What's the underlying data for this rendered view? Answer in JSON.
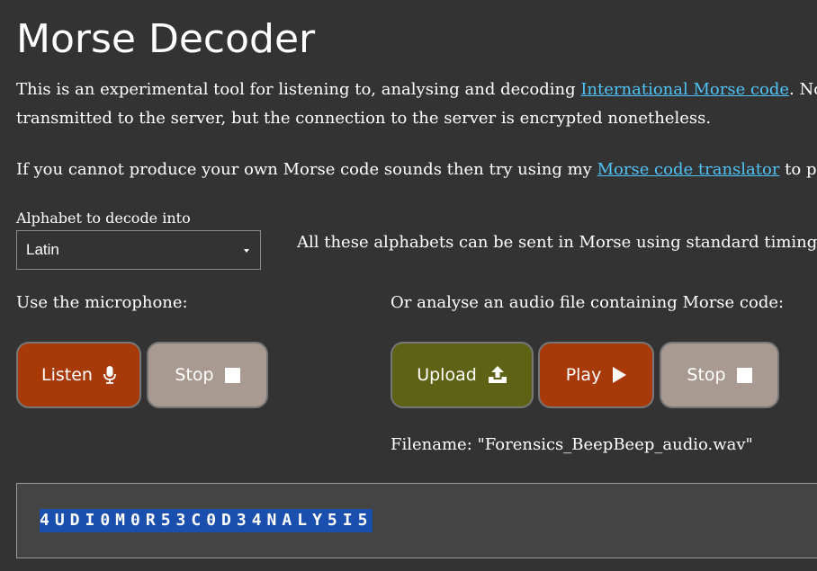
{
  "page": {
    "title": "Morse Decoder"
  },
  "intro": {
    "line1_prefix": "This is an experimental tool for listening to, analysing and decoding ",
    "line1_link": "International Morse code",
    "line1_suffix": ". No information about the sounds or decoded text is",
    "line2": "transmitted to the server, but the connection to the server is encrypted nonetheless."
  },
  "translator_note": {
    "prefix": "If you cannot produce your own Morse code sounds then try using my ",
    "link": "Morse code translator",
    "suffix": " to play code from your computer."
  },
  "alphabet": {
    "label": "Alphabet to decode into",
    "selected": "Latin",
    "note": "All these alphabets can be sent in Morse using standard timing. The"
  },
  "microphone": {
    "label": "Use the microphone:",
    "listen_label": "Listen",
    "stop_label": "Stop"
  },
  "file": {
    "label": "Or analyse an audio file containing Morse code:",
    "upload_label": "Upload",
    "play_label": "Play",
    "stop_label": "Stop",
    "filename": "Filename: \"Forensics_BeepBeep_audio.wav\""
  },
  "output": {
    "text": "4UDI0M0R53C0D34NALY5I5"
  },
  "colors": {
    "background": "#333333",
    "link": "#4fc3f7",
    "listen_button": "#a83a0a",
    "play_button": "#a83a0a",
    "upload_button": "#5e6214",
    "stop_button": "#a89a90",
    "output_highlight": "#1a4fae"
  },
  "icons": {
    "listen": "microphone-icon",
    "stop": "stop-square-icon",
    "upload": "upload-icon",
    "play": "play-icon"
  }
}
